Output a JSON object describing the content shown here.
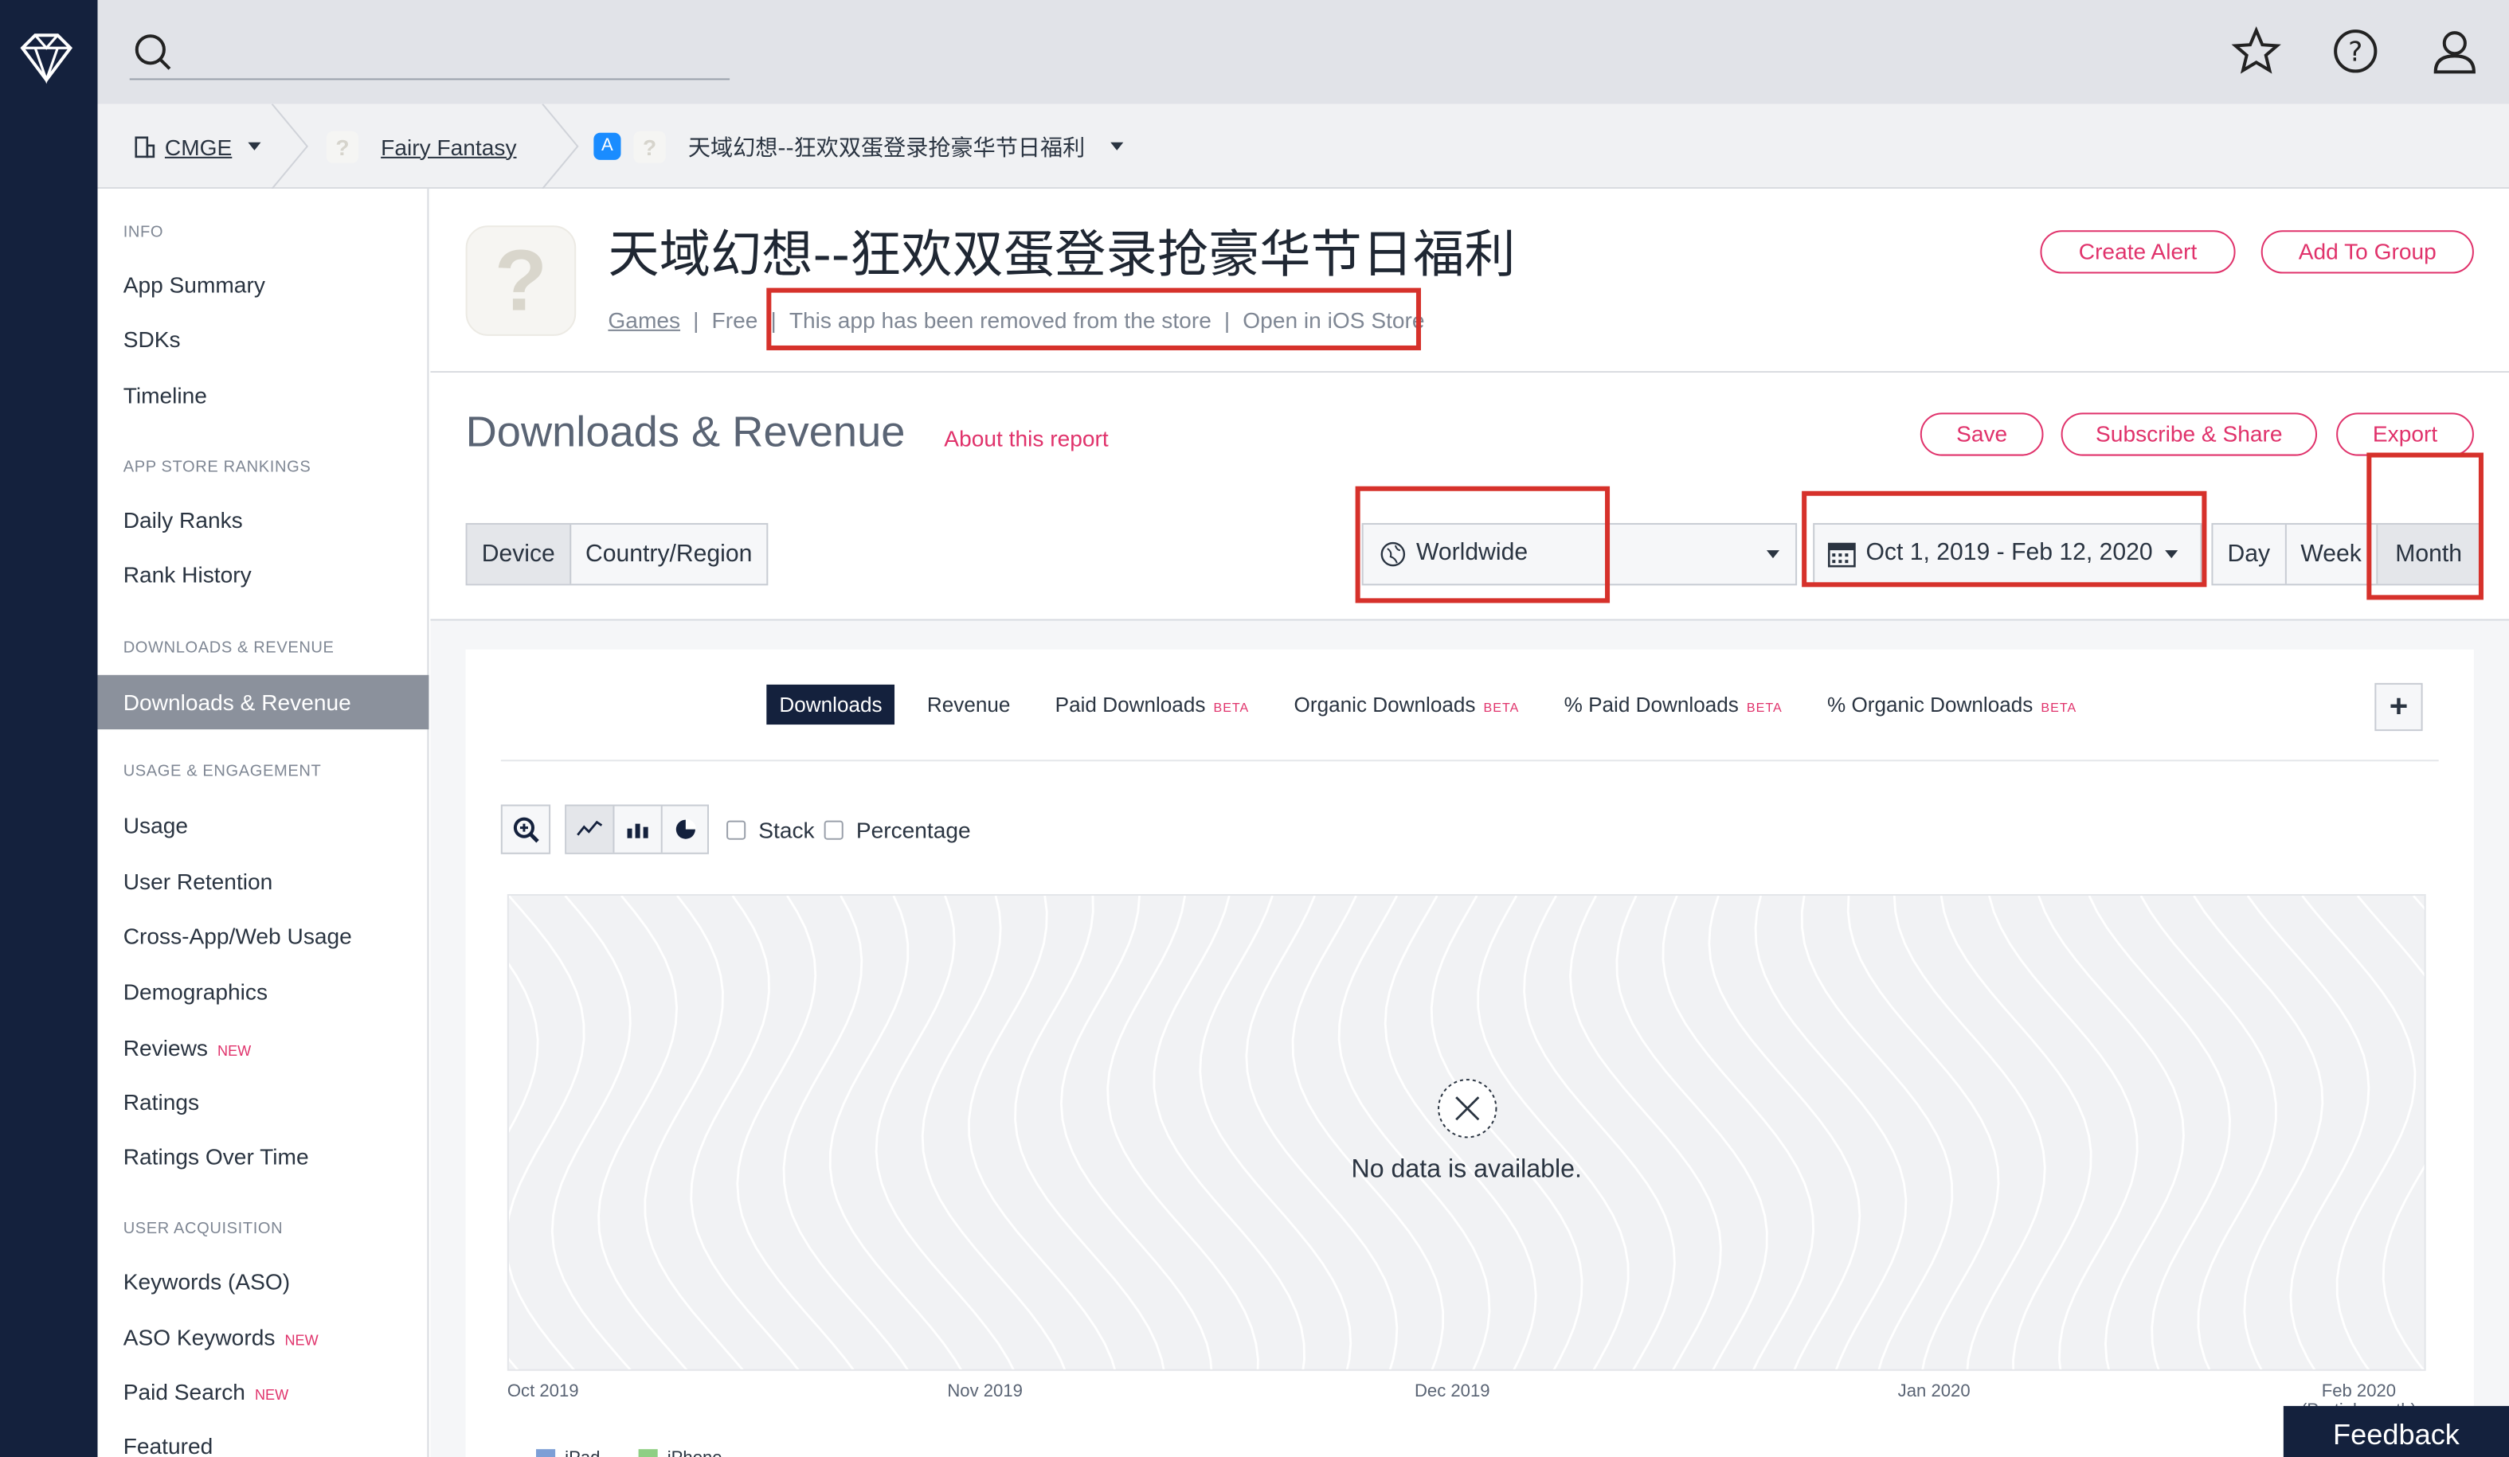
{
  "header": {
    "search_placeholder": "",
    "icons": [
      "star-icon",
      "help-icon",
      "user-icon"
    ]
  },
  "breadcrumb": {
    "company": "CMGE",
    "app": "Fairy Fantasy",
    "current": "天域幻想--狂欢双蛋登录抢豪华节日福利"
  },
  "sidebar": {
    "sections": [
      {
        "title": "INFO",
        "items": [
          "App Summary",
          "SDKs",
          "Timeline"
        ]
      },
      {
        "title": "APP STORE RANKINGS",
        "items": [
          "Daily Ranks",
          "Rank History"
        ]
      },
      {
        "title": "DOWNLOADS & REVENUE",
        "items": [
          "Downloads & Revenue"
        ]
      },
      {
        "title": "USAGE & ENGAGEMENT",
        "items": [
          "Usage",
          "User Retention",
          "Cross-App/Web Usage",
          "Demographics",
          "Reviews",
          "Ratings",
          "Ratings Over Time"
        ]
      },
      {
        "title": "USER ACQUISITION",
        "items": [
          "Keywords (ASO)",
          "ASO Keywords",
          "Paid Search",
          "Featured"
        ]
      }
    ],
    "new_label": "NEW"
  },
  "app": {
    "title": "天域幻想--狂欢双蛋登录抢豪华节日福利",
    "category": "Games",
    "price": "Free",
    "removed_notice": "This app has been removed from the store",
    "open_store": "Open in iOS Store",
    "create_alert": "Create Alert",
    "add_to_group": "Add To Group"
  },
  "report": {
    "title": "Downloads & Revenue",
    "about": "About this report",
    "save": "Save",
    "subscribe": "Subscribe & Share",
    "export": "Export",
    "breakdown": [
      "Device",
      "Country/Region"
    ],
    "region": "Worldwide",
    "date_range": "Oct 1, 2019 - Feb 12, 2020",
    "granularity": [
      "Day",
      "Week",
      "Month"
    ],
    "granularity_selected": "Month"
  },
  "chart": {
    "tabs": [
      "Downloads",
      "Revenue",
      "Paid Downloads",
      "Organic Downloads",
      "% Paid Downloads",
      "% Organic Downloads"
    ],
    "beta": "BETA",
    "stack": "Stack",
    "percentage": "Percentage",
    "no_data": "No data is available.",
    "partial": "(Partial month)",
    "legend": [
      "iPad",
      "iPhone"
    ],
    "colors": {
      "ipad": "#7d9fd6",
      "iphone": "#8fcf84"
    }
  },
  "chart_data": {
    "type": "line",
    "x": [
      "Oct 2019",
      "Nov 2019",
      "Dec 2019",
      "Jan 2020",
      "Feb 2020"
    ],
    "series": [
      {
        "name": "iPad",
        "values": []
      },
      {
        "name": "iPhone",
        "values": []
      }
    ]
  },
  "feedback": "Feedback"
}
